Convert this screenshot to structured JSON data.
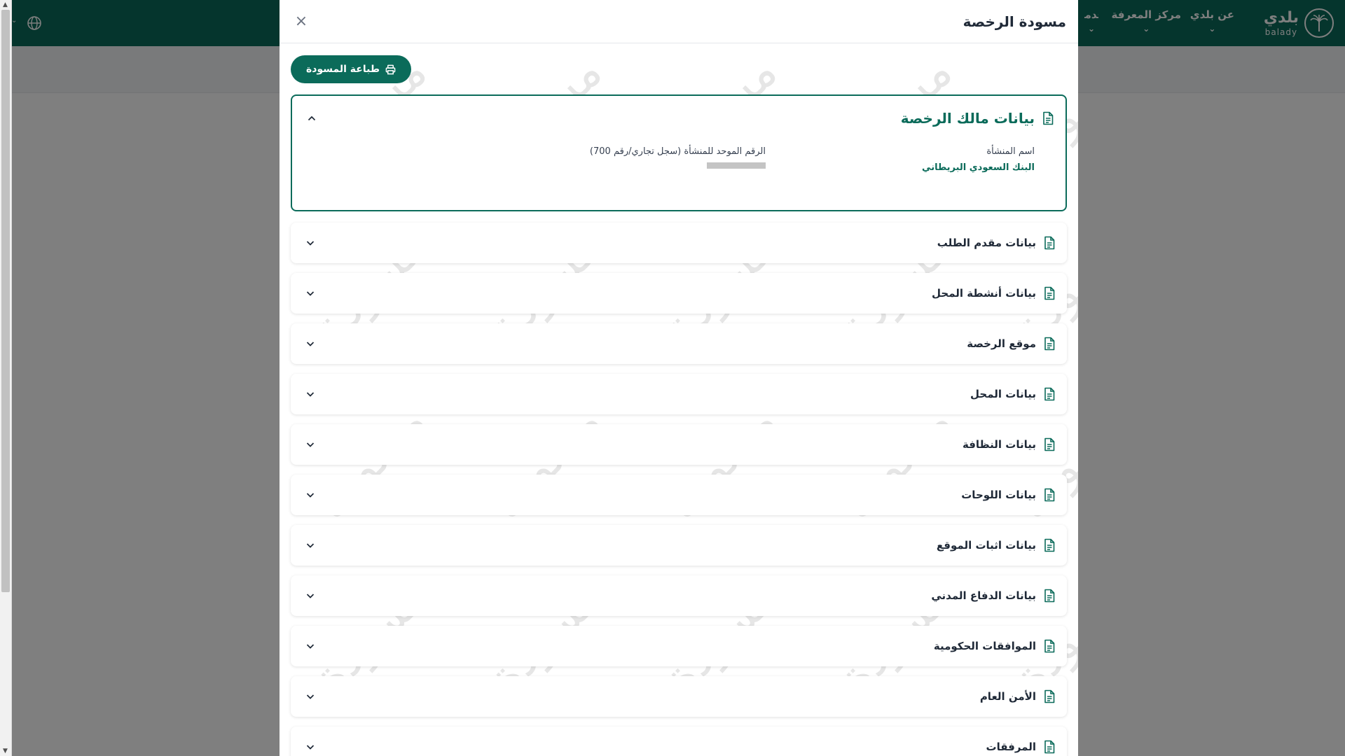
{
  "background": {
    "brand": {
      "arabic": "بلدي",
      "latin": "balady"
    },
    "nav": {
      "about": "عن بلدي",
      "knowledge": "مركز المعرفة",
      "services": "الخدمات"
    }
  },
  "modal": {
    "title": "مسودة الرخصة",
    "close_symbol": "×",
    "print_label": "طباعة المسودة",
    "owner_section": {
      "title": "بيانات مالك الرخصة",
      "fields": [
        {
          "label": "اسم المنشأة",
          "value": "البنك السعودي البريطاني"
        },
        {
          "label": "الرقم الموحد للمنشأة (سجل تجاري/رقم 700)",
          "value": ""
        }
      ]
    },
    "sections": [
      {
        "title": "بيانات مقدم الطلب"
      },
      {
        "title": "بيانات أنشطة المحل"
      },
      {
        "title": "موقع الرخصة"
      },
      {
        "title": "بيانات المحل"
      },
      {
        "title": "بيانات النظافة"
      },
      {
        "title": "بيانات اللوحات"
      },
      {
        "title": "بيانات اثبات الموقع"
      },
      {
        "title": "بيانات الدفاع المدني"
      },
      {
        "title": "الموافقات الحكومية"
      },
      {
        "title": "الأمن العام"
      },
      {
        "title": "المرفقات"
      }
    ],
    "watermark_text": "مسودة"
  },
  "colors": {
    "primary": "#0b6b5a",
    "overlay": "rgba(0,0,0,0.5)",
    "redacted": "#c4c4c4"
  },
  "icons": {
    "section": "document-icon",
    "collapsed": "chevron-down-icon",
    "expanded": "chevron-up-icon",
    "print": "printer-icon",
    "close": "close-icon"
  }
}
